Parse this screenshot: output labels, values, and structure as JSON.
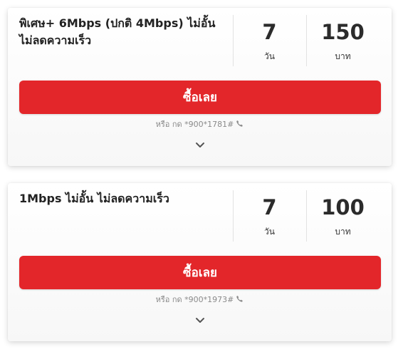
{
  "packages": [
    {
      "title": "พิเศษ+ 6Mbps (ปกติ 4Mbps) ไม่อั้น ไม่ลดความเร็ว",
      "days": "7",
      "days_unit": "วัน",
      "price": "150",
      "price_unit": "บาท",
      "buy_label": "ซื้อเลย",
      "dial_prefix": "หรือ กด",
      "dial_code": "*900*1781#"
    },
    {
      "title": "1Mbps ไม่อั้น ไม่ลดความเร็ว",
      "days": "7",
      "days_unit": "วัน",
      "price": "100",
      "price_unit": "บาท",
      "buy_label": "ซื้อเลย",
      "dial_prefix": "หรือ กด",
      "dial_code": "*900*1973#"
    }
  ],
  "icons": {
    "phone": "phone-icon",
    "expand": "chevron-down-icon"
  },
  "colors": {
    "buy_button": "#e3262a",
    "title_text": "#222222",
    "muted_text": "#8a8a8a"
  }
}
